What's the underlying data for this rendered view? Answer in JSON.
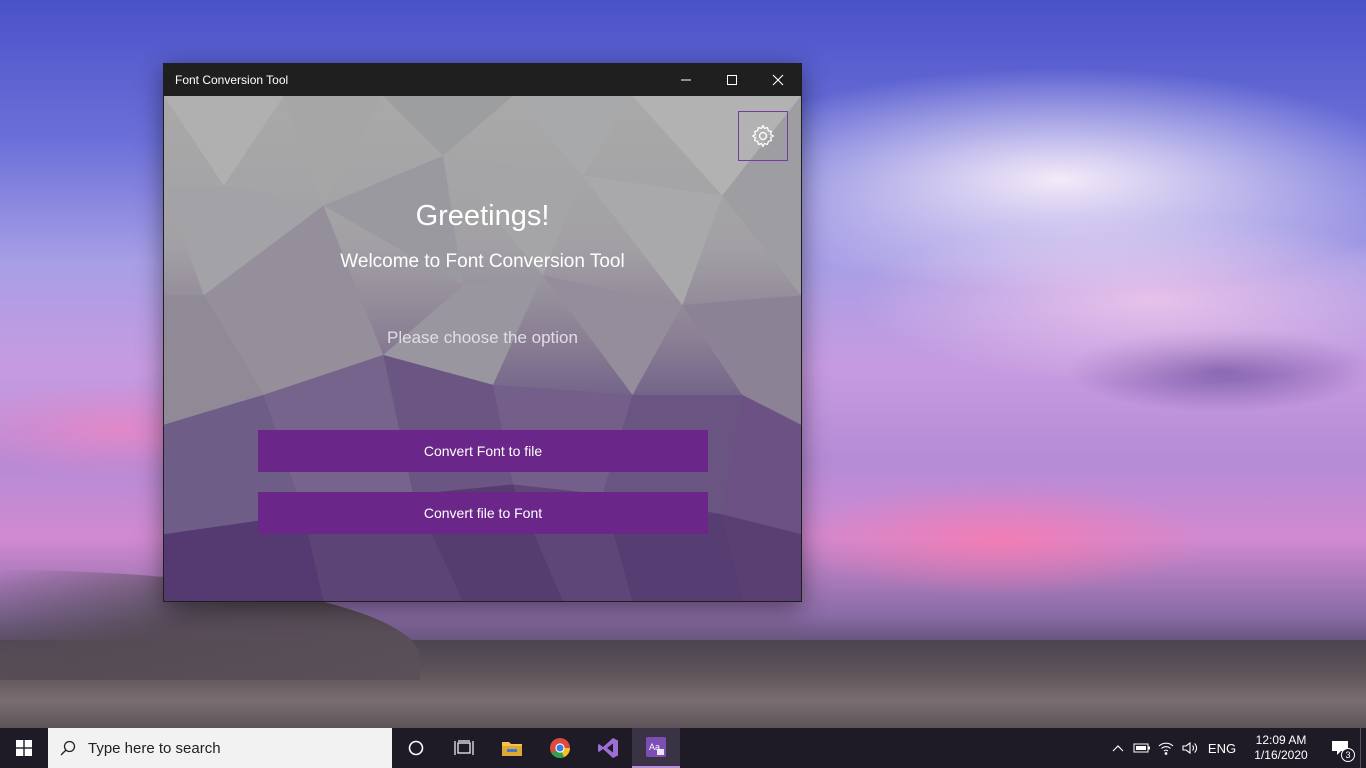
{
  "window": {
    "title": "Font Conversion Tool",
    "minimize_icon": "minimize-icon",
    "maximize_icon": "maximize-icon",
    "close_icon": "close-icon"
  },
  "app": {
    "settings_icon": "gear-icon",
    "greeting": "Greetings!",
    "welcome": "Welcome to Font Conversion Tool",
    "prompt": "Please choose the option",
    "buttons": [
      "Convert Font to file",
      "Convert file to Font"
    ],
    "accent_color": "#6a2688"
  },
  "taskbar": {
    "search_placeholder": "Type here to search",
    "apps": [
      "task-view",
      "file-explorer",
      "chrome",
      "visual-studio",
      "font-conversion-tool"
    ],
    "tray": {
      "language": "ENG",
      "time": "12:09 AM",
      "date": "1/16/2020",
      "notifications": "3"
    }
  }
}
